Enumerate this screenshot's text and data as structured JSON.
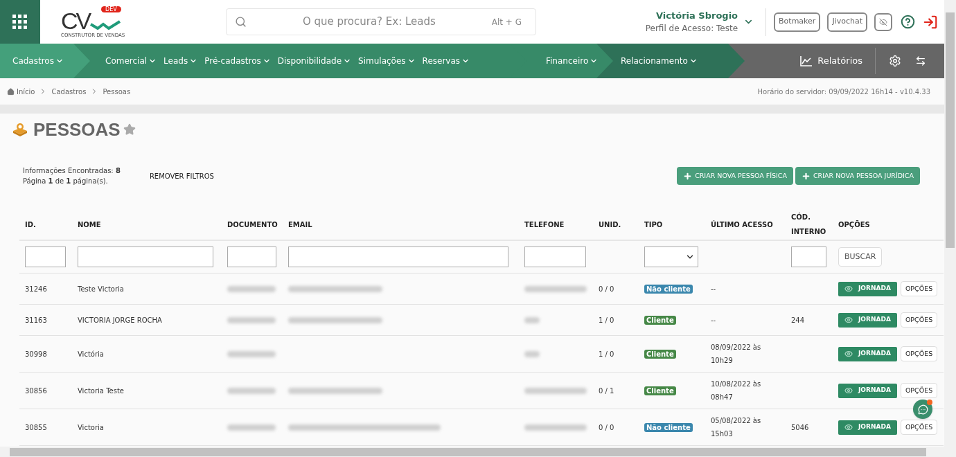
{
  "header": {
    "logo": {
      "mark": "CV",
      "badge": "DEV",
      "tagline": "CONSTRUTOR DE VENDAS"
    },
    "search": {
      "placeholder": "O que procura? Ex: Leads",
      "shortcut": "Alt + G"
    },
    "user": {
      "name": "Victória Sbrogio",
      "profile": "Perfil de Acesso: Teste"
    },
    "buttons": [
      "Botmaker",
      "Jivochat"
    ]
  },
  "nav": {
    "groups": [
      {
        "color": "#44a07b",
        "items": [
          "Cadastros"
        ]
      },
      {
        "color": "#378a68",
        "items": [
          "Comercial",
          "Leads",
          "Pré-cadastros",
          "Disponibilidade",
          "Simulações",
          "Reservas"
        ]
      },
      {
        "color": "#378a68",
        "items": [
          "Financeiro"
        ]
      },
      {
        "color": "#2e7158",
        "items": [
          "Relacionamento"
        ]
      }
    ],
    "reports": "Relatórios"
  },
  "breadcrumb": [
    "Início",
    "Cadastros",
    "Pessoas"
  ],
  "server_time": "Horário do servidor: 09/09/2022 16h14 - v10.4.33",
  "page": {
    "title": "PESSOAS",
    "info": "Informações Encontradas: **8**",
    "pages": "Página **1** de **1** página(s).",
    "remove_filters": "REMOVER FILTROS",
    "actions": [
      "CRIAR NOVA PESSOA FÍSICA",
      "CRIAR NOVA PESSOA JURÍDICA"
    ]
  },
  "table": {
    "columns": [
      {
        "label": "ID.",
        "kind": "text"
      },
      {
        "label": "NOME",
        "kind": "text"
      },
      {
        "label": "DOCUMENTO",
        "kind": "text"
      },
      {
        "label": "EMAIL",
        "kind": "text"
      },
      {
        "label": "TELEFONE",
        "kind": "text"
      },
      {
        "label": "UNID.",
        "kind": "none"
      },
      {
        "label": "TIPO",
        "kind": "select"
      },
      {
        "label": "ÚLTIMO ACESSO",
        "kind": "none"
      },
      {
        "label": "CÓD. INTERNO",
        "kind": "text"
      },
      {
        "label": "OPÇÕES",
        "kind": "button"
      }
    ],
    "search_button": "BUSCAR",
    "rows": [
      {
        "id": "31246",
        "name": "Teste Victoria",
        "document_blurred": true,
        "email_blurred": true,
        "phone_blurred": true,
        "units": "0 / 0",
        "type": {
          "label": "Não cliente",
          "color": "#3a87ad"
        },
        "last_access": "--",
        "journey": "JORNADA",
        "options": "OPÇÕES"
      },
      {
        "id": "31163",
        "name": "VICTORIA JORGE ROCHA",
        "document_blurred": true,
        "email_blurred": true,
        "phone_blurred": true,
        "units": "1 / 0",
        "type": {
          "label": "Cliente",
          "color": "#468847"
        },
        "last_access": "--",
        "internal_code": "244",
        "journey": "JORNADA",
        "options": "OPÇÕES"
      },
      {
        "id": "30998",
        "name": "Victória",
        "document_blurred": true,
        "email_blurred": false,
        "phone_blurred": true,
        "units": "1 / 0",
        "type": {
          "label": "Cliente",
          "color": "#468847"
        },
        "last_access": "08/09/2022 às 10h29",
        "journey": "JORNADA",
        "options": "OPÇÕES"
      },
      {
        "id": "30856",
        "name": "Victoria Teste",
        "document_blurred": true,
        "email_blurred": true,
        "phone_blurred": true,
        "units": "0 / 1",
        "type": {
          "label": "Cliente",
          "color": "#468847"
        },
        "last_access": "10/08/2022 às 08h47",
        "journey": "JORNADA",
        "options": "OPÇÕES"
      },
      {
        "id": "30855",
        "name": "Victoria",
        "document_blurred": true,
        "email_blurred": true,
        "phone_blurred": true,
        "units": "0 / 0",
        "type": {
          "label": "Não cliente",
          "color": "#3a87ad"
        },
        "last_access": "05/08/2022 às 15h03",
        "internal_code": "5046",
        "journey": "JORNADA",
        "options": "OPÇÕES"
      }
    ]
  }
}
